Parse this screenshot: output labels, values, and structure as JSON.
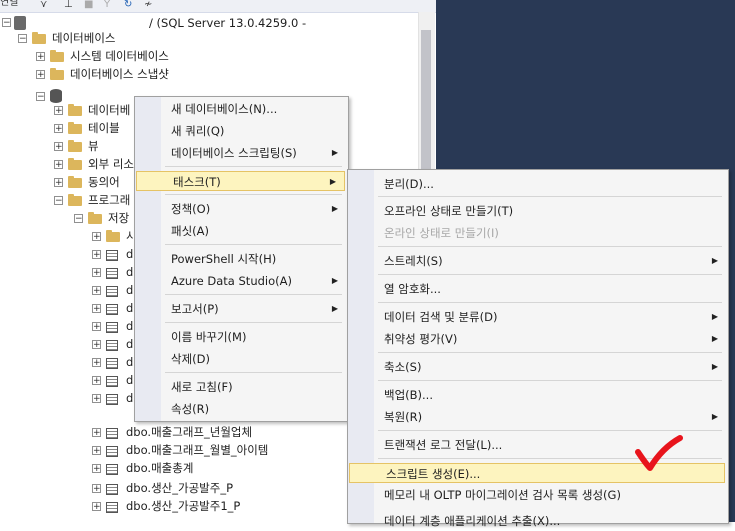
{
  "toolbar": {
    "connect_label": "연결",
    "icon_names": [
      "plug-icon",
      "disconnect-icon",
      "stop-icon",
      "filter-icon",
      "refresh-icon",
      "activity-icon"
    ]
  },
  "tree": {
    "server_label": "/ (SQL Server 13.0.4259.0 -",
    "nodes": [
      {
        "id": "databases",
        "label": "데이터베이스",
        "icon": "folder-icon",
        "expander": "−"
      },
      {
        "id": "system-databases",
        "label": "시스템 데이터베이스",
        "icon": "folder-icon",
        "expander": "+"
      },
      {
        "id": "database-snapshots",
        "label": "데이터베이스 스냅샷",
        "icon": "folder-icon",
        "expander": "+"
      },
      {
        "id": "selected-database",
        "label": "",
        "icon": "database-icon",
        "expander": "−"
      },
      {
        "id": "database-diagrams",
        "label": "데이터베",
        "icon": "folder-icon",
        "expander": "+"
      },
      {
        "id": "tables",
        "label": "테이블",
        "icon": "folder-icon",
        "expander": "+"
      },
      {
        "id": "views",
        "label": "뷰",
        "icon": "folder-icon",
        "expander": "+"
      },
      {
        "id": "external-resources",
        "label": "외부 리소",
        "icon": "folder-icon",
        "expander": "+"
      },
      {
        "id": "synonyms",
        "label": "동의어",
        "icon": "folder-icon",
        "expander": "+"
      },
      {
        "id": "programmability",
        "label": "프로그래",
        "icon": "folder-icon",
        "expander": "−"
      },
      {
        "id": "stored-procedures",
        "label": "저장",
        "icon": "folder-icon",
        "expander": "−"
      },
      {
        "id": "system-procs",
        "label": "시",
        "icon": "folder-icon",
        "expander": "+"
      },
      {
        "id": "proc-1",
        "label": "db",
        "icon": "table-icon",
        "expander": "+"
      },
      {
        "id": "proc-2",
        "label": "d",
        "icon": "table-icon",
        "expander": "+"
      },
      {
        "id": "proc-3",
        "label": "d",
        "icon": "table-icon",
        "expander": "+"
      },
      {
        "id": "proc-4",
        "label": "d",
        "icon": "table-icon",
        "expander": "+"
      },
      {
        "id": "proc-5",
        "label": "d",
        "icon": "table-icon",
        "expander": "+"
      },
      {
        "id": "proc-6",
        "label": "d",
        "icon": "table-icon",
        "expander": "+"
      },
      {
        "id": "proc-7",
        "label": "d",
        "icon": "table-icon",
        "expander": "+"
      },
      {
        "id": "proc-8",
        "label": "d",
        "icon": "table-icon",
        "expander": "+"
      },
      {
        "id": "proc-9",
        "label": "d",
        "icon": "table-icon",
        "expander": "+"
      },
      {
        "id": "proc-10",
        "label": "dbo.매출그래프_년월업체",
        "icon": "table-icon",
        "expander": "+"
      },
      {
        "id": "proc-11",
        "label": "dbo.매출그래프_월별_아이템",
        "icon": "table-icon",
        "expander": "+"
      },
      {
        "id": "proc-12",
        "label": "dbo.매출총계",
        "icon": "table-icon",
        "expander": "+"
      },
      {
        "id": "proc-13",
        "label": "dbo.생산_가공발주_P",
        "icon": "table-icon",
        "expander": "+"
      },
      {
        "id": "proc-14",
        "label": "dbo.생산_가공발주1_P",
        "icon": "table-icon",
        "expander": "+"
      }
    ]
  },
  "context_menu": {
    "items": [
      {
        "label": "새 데이터베이스(N)...",
        "arrow": ""
      },
      {
        "label": "새 쿼리(Q)",
        "arrow": ""
      },
      {
        "label": "데이터베이스 스크립팅(S)",
        "arrow": "▶"
      },
      {
        "label": "태스크(T)",
        "arrow": "▶"
      },
      {
        "label": "정책(O)",
        "arrow": "▶"
      },
      {
        "label": "패싯(A)",
        "arrow": ""
      },
      {
        "label": "PowerShell 시작(H)",
        "arrow": ""
      },
      {
        "label": "Azure Data Studio(A)",
        "arrow": "▶"
      },
      {
        "label": "보고서(P)",
        "arrow": "▶"
      },
      {
        "label": "이름 바꾸기(M)",
        "arrow": ""
      },
      {
        "label": "삭제(D)",
        "arrow": ""
      },
      {
        "label": "새로 고침(F)",
        "arrow": ""
      },
      {
        "label": "속성(R)",
        "arrow": ""
      }
    ]
  },
  "tasks_submenu": {
    "items": [
      {
        "label": "분리(D)...",
        "arrow": ""
      },
      {
        "label": "오프라인 상태로 만들기(T)",
        "arrow": ""
      },
      {
        "label": "온라인 상태로 만들기(I)",
        "arrow": "",
        "disabled": true
      },
      {
        "label": "스트레치(S)",
        "arrow": "▶"
      },
      {
        "label": "열 암호화...",
        "arrow": ""
      },
      {
        "label": "데이터 검색 및 분류(D)",
        "arrow": "▶"
      },
      {
        "label": "취약성 평가(V)",
        "arrow": "▶"
      },
      {
        "label": "축소(S)",
        "arrow": "▶"
      },
      {
        "label": "백업(B)...",
        "arrow": ""
      },
      {
        "label": "복원(R)",
        "arrow": "▶"
      },
      {
        "label": "트랜잭션 로그 전달(L)...",
        "arrow": ""
      },
      {
        "label": "스크립트 생성(E)...",
        "arrow": ""
      },
      {
        "label": "메모리 내 OLTP 마이그레이션 검사 목록 생성(G)",
        "arrow": ""
      },
      {
        "label": "데이터 계층 애플리케이션 추출(X)...",
        "arrow": ""
      }
    ]
  },
  "colors": {
    "highlight_bg": "#fdf4bf",
    "highlight_border": "#e5c365",
    "background_right": "#293955",
    "checkmark": "#e8141c"
  }
}
